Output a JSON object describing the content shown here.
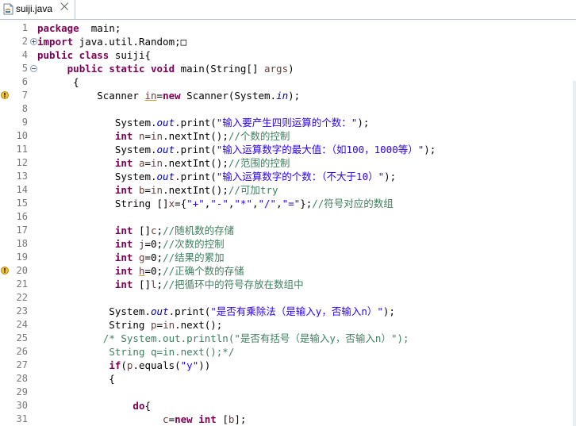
{
  "tab": {
    "filename": "suiji.java",
    "close_glyph": "⨉"
  },
  "code_lines": [
    {
      "n": "1",
      "segs": [
        [
          "kw",
          "package"
        ],
        [
          "",
          "  main;"
        ]
      ]
    },
    {
      "n": "2",
      "fold": "plus",
      "segs": [
        [
          "kw",
          "import"
        ],
        [
          "",
          " java.util.Random;"
        ],
        [
          "",
          "□"
        ]
      ]
    },
    {
      "n": "4",
      "segs": [
        [
          "kw",
          "public class"
        ],
        [
          "",
          " suiji{"
        ]
      ]
    },
    {
      "n": "5",
      "fold": "minus",
      "segs": [
        [
          "",
          "     "
        ],
        [
          "kw",
          "public static void"
        ],
        [
          "",
          " main(String[] "
        ],
        [
          "var",
          "args"
        ],
        [
          "",
          ")"
        ]
      ]
    },
    {
      "n": "6",
      "segs": [
        [
          "",
          "      {"
        ]
      ]
    },
    {
      "n": "7",
      "warn": true,
      "segs": [
        [
          "",
          "          Scanner "
        ],
        [
          "var ul",
          "in"
        ],
        [
          "",
          "="
        ],
        [
          "kw",
          "new"
        ],
        [
          "",
          " Scanner(System."
        ],
        [
          "fld",
          "in"
        ],
        [
          "",
          ");"
        ]
      ]
    },
    {
      "n": "8",
      "segs": []
    },
    {
      "n": "9",
      "segs": [
        [
          "",
          "             System."
        ],
        [
          "fld",
          "out"
        ],
        [
          "",
          ".print("
        ],
        [
          "str",
          "\"输入要产生四则运算的个数：\""
        ],
        [
          "",
          ");"
        ]
      ]
    },
    {
      "n": "10",
      "segs": [
        [
          "",
          "             "
        ],
        [
          "kw",
          "int"
        ],
        [
          "",
          " "
        ],
        [
          "var",
          "n"
        ],
        [
          "",
          "="
        ],
        [
          "var",
          "in"
        ],
        [
          "",
          ".nextInt();"
        ],
        [
          "cm",
          "//个数的控制"
        ]
      ]
    },
    {
      "n": "11",
      "segs": [
        [
          "",
          "             System."
        ],
        [
          "fld",
          "out"
        ],
        [
          "",
          ".print("
        ],
        [
          "str",
          "\"输入运算数字的最大值：（如100，1000等）\""
        ],
        [
          "",
          ");"
        ]
      ]
    },
    {
      "n": "12",
      "segs": [
        [
          "",
          "             "
        ],
        [
          "kw",
          "int"
        ],
        [
          "",
          " "
        ],
        [
          "var",
          "a"
        ],
        [
          "",
          "="
        ],
        [
          "var",
          "in"
        ],
        [
          "",
          ".nextInt();"
        ],
        [
          "cm",
          "//范围的控制"
        ]
      ]
    },
    {
      "n": "13",
      "segs": [
        [
          "",
          "             System."
        ],
        [
          "fld",
          "out"
        ],
        [
          "",
          ".print("
        ],
        [
          "str",
          "\"输入运算数字的个数：（不大于10）\""
        ],
        [
          "",
          ");"
        ]
      ]
    },
    {
      "n": "14",
      "segs": [
        [
          "",
          "             "
        ],
        [
          "kw",
          "int"
        ],
        [
          "",
          " "
        ],
        [
          "var",
          "b"
        ],
        [
          "",
          "="
        ],
        [
          "var",
          "in"
        ],
        [
          "",
          ".nextInt();"
        ],
        [
          "cm",
          "//可加try"
        ]
      ]
    },
    {
      "n": "15",
      "segs": [
        [
          "",
          "             String []"
        ],
        [
          "var",
          "x"
        ],
        [
          "",
          "={"
        ],
        [
          "str",
          "\"+\""
        ],
        [
          "",
          ","
        ],
        [
          "str",
          "\"-\""
        ],
        [
          "",
          ","
        ],
        [
          "str",
          "\"*\""
        ],
        [
          "",
          ","
        ],
        [
          "str",
          "\"/\""
        ],
        [
          "",
          ","
        ],
        [
          "str",
          "\"=\""
        ],
        [
          "",
          "};"
        ],
        [
          "cm",
          "//符号对应的数组"
        ]
      ]
    },
    {
      "n": "16",
      "segs": []
    },
    {
      "n": "17",
      "segs": [
        [
          "",
          "             "
        ],
        [
          "kw",
          "int"
        ],
        [
          "",
          " []"
        ],
        [
          "var",
          "c"
        ],
        [
          "",
          ";"
        ],
        [
          "cm",
          "//随机数的存储"
        ]
      ]
    },
    {
      "n": "18",
      "segs": [
        [
          "",
          "             "
        ],
        [
          "kw",
          "int"
        ],
        [
          "",
          " "
        ],
        [
          "var",
          "j"
        ],
        [
          "",
          "=0;"
        ],
        [
          "cm",
          "//次数的控制"
        ]
      ]
    },
    {
      "n": "19",
      "segs": [
        [
          "",
          "             "
        ],
        [
          "kw",
          "int"
        ],
        [
          "",
          " "
        ],
        [
          "var",
          "g"
        ],
        [
          "",
          "=0;"
        ],
        [
          "cm",
          "//结果的累加"
        ]
      ]
    },
    {
      "n": "20",
      "warn": true,
      "segs": [
        [
          "",
          "             "
        ],
        [
          "kw",
          "int"
        ],
        [
          "",
          " "
        ],
        [
          "var ul",
          "h"
        ],
        [
          "",
          "=0;"
        ],
        [
          "cm",
          "//正确个数的存储"
        ]
      ]
    },
    {
      "n": "21",
      "segs": [
        [
          "",
          "             "
        ],
        [
          "kw",
          "int"
        ],
        [
          "",
          " []"
        ],
        [
          "var",
          "l"
        ],
        [
          "",
          ";"
        ],
        [
          "cm",
          "//把循环中的符号存放在数组中"
        ]
      ]
    },
    {
      "n": "22",
      "segs": []
    },
    {
      "n": "23",
      "segs": [
        [
          "",
          "            System."
        ],
        [
          "fld",
          "out"
        ],
        [
          "",
          ".print("
        ],
        [
          "str",
          "\"是否有乘除法（是输入y，否输入n）\""
        ],
        [
          "",
          ");"
        ]
      ]
    },
    {
      "n": "24",
      "segs": [
        [
          "",
          "            String "
        ],
        [
          "var",
          "p"
        ],
        [
          "",
          "="
        ],
        [
          "var",
          "in"
        ],
        [
          "",
          ".next();"
        ]
      ]
    },
    {
      "n": "25",
      "segs": [
        [
          "",
          "           "
        ],
        [
          "cm",
          "/* System.out.println(\"是否有括号（是输入y，否输入n）\");"
        ]
      ]
    },
    {
      "n": "26",
      "segs": [
        [
          "",
          "            "
        ],
        [
          "cm",
          "String q=in.next();*/"
        ]
      ]
    },
    {
      "n": "27",
      "segs": [
        [
          "",
          "            "
        ],
        [
          "kw",
          "if"
        ],
        [
          "",
          "("
        ],
        [
          "var",
          "p"
        ],
        [
          "",
          ".equals("
        ],
        [
          "str",
          "\"y\""
        ],
        [
          "",
          "))"
        ]
      ]
    },
    {
      "n": "28",
      "segs": [
        [
          "",
          "            {"
        ]
      ]
    },
    {
      "n": "29",
      "segs": []
    },
    {
      "n": "30",
      "segs": [
        [
          "",
          "                "
        ],
        [
          "kw",
          "do"
        ],
        [
          "",
          "{"
        ]
      ]
    },
    {
      "n": "31",
      "segs": [
        [
          "",
          "                     "
        ],
        [
          "var",
          "c"
        ],
        [
          "",
          "="
        ],
        [
          "kw",
          "new"
        ],
        [
          "",
          " "
        ],
        [
          "kw",
          "int"
        ],
        [
          "",
          " ["
        ],
        [
          "var",
          "b"
        ],
        [
          "",
          "];"
        ]
      ]
    }
  ]
}
